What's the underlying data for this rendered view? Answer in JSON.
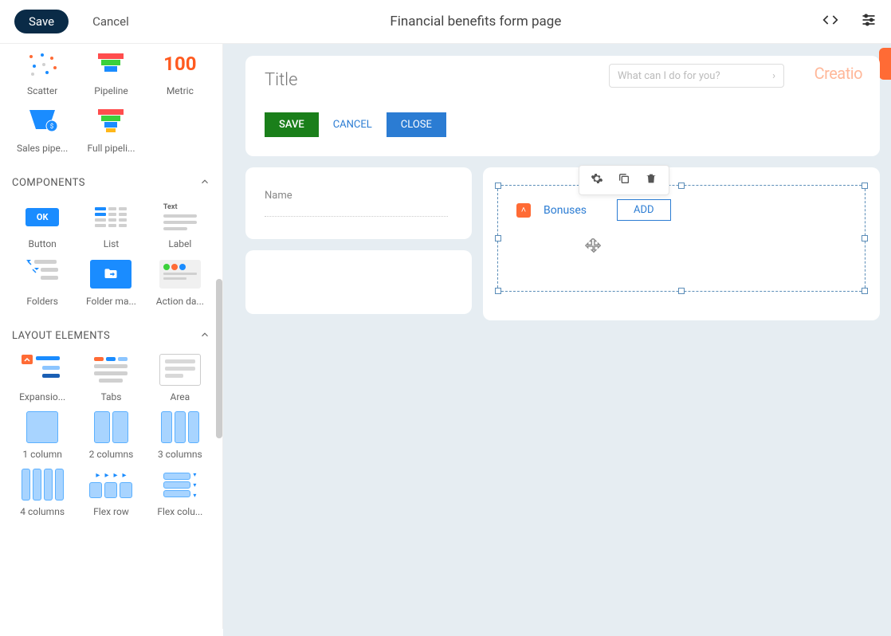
{
  "topbar": {
    "save": "Save",
    "cancel": "Cancel",
    "title": "Financial benefits form page"
  },
  "sidebar": {
    "charts": {
      "scatter": "Scatter",
      "pipeline": "Pipeline",
      "metric": "Metric",
      "metric_value": "100",
      "sales_pipeline": "Sales pipe...",
      "full_pipeline": "Full pipeli..."
    },
    "components": {
      "title": "COMPONENTS",
      "button": "Button",
      "button_text": "OK",
      "list": "List",
      "label": "Label",
      "label_text": "Text",
      "folders": "Folders",
      "folder_management": "Folder ma...",
      "action_dashboard": "Action da..."
    },
    "layout": {
      "title": "LAYOUT ELEMENTS",
      "expansion": "Expansio...",
      "tabs": "Tabs",
      "area": "Area",
      "col1": "1 column",
      "col2": "2 columns",
      "col3": "3 columns",
      "col4": "4 columns",
      "flexrow": "Flex row",
      "flexcol": "Flex colu..."
    }
  },
  "canvas": {
    "header": {
      "title": "Title",
      "search_placeholder": "What can I do for you?",
      "brand": "Creatio",
      "save": "SAVE",
      "cancel": "CANCEL",
      "close": "CLOSE"
    },
    "name_card": {
      "label": "Name"
    },
    "bonuses": {
      "label": "Bonuses",
      "add": "ADD"
    }
  }
}
